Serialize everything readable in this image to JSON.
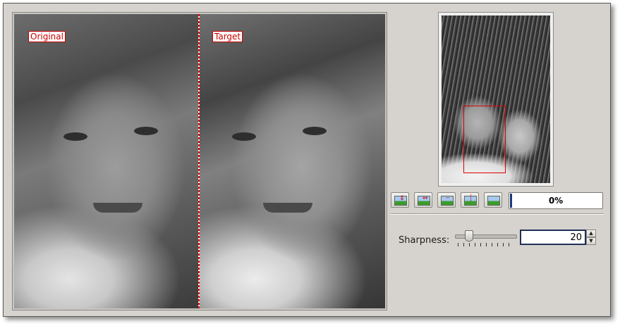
{
  "preview": {
    "left_label": "Original",
    "right_label": "Target"
  },
  "toolbar": {
    "buttons": [
      {
        "name": "preview-horizontal-button",
        "icon": "split-horizontal-icon"
      },
      {
        "name": "preview-vertical-button",
        "icon": "split-vertical-icon"
      },
      {
        "name": "preview-horizontal-cont-button",
        "icon": "split-horizontal-cont-icon"
      },
      {
        "name": "preview-vertical-cont-button",
        "icon": "split-vertical-cont-icon"
      },
      {
        "name": "preview-target-button",
        "icon": "image-icon"
      }
    ],
    "progress_text": "0%",
    "progress_value": 0
  },
  "settings": {
    "sharpness_label": "Sharpness:",
    "sharpness_value": "20"
  },
  "colors": {
    "accent_red": "#cc0000",
    "focus_border": "#1e2f5a",
    "window_bg": "#d6d3ce"
  }
}
